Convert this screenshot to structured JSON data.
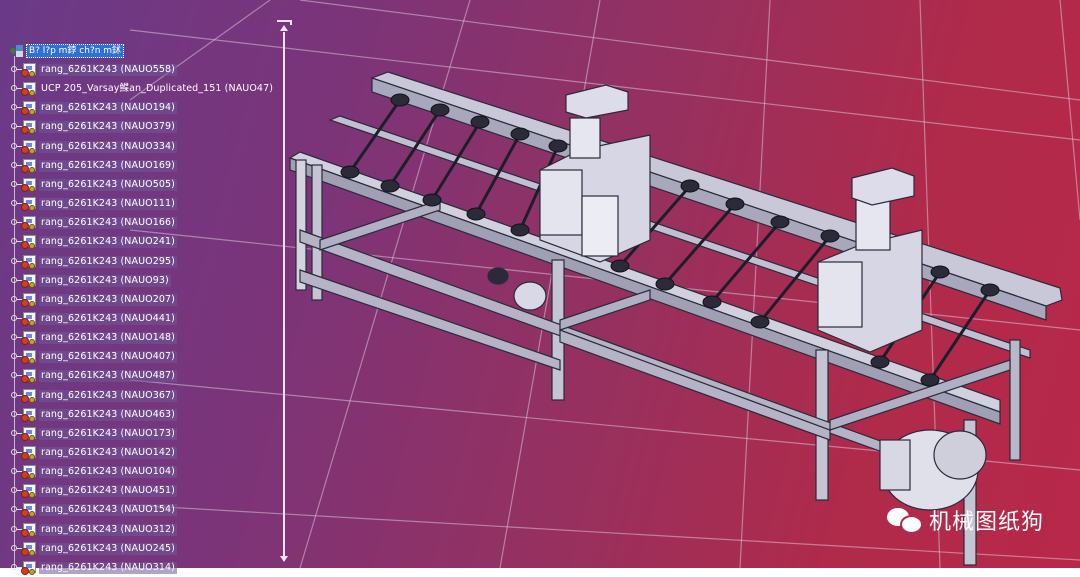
{
  "viewport": {
    "background_left": "#6a3a88",
    "background_right": "#b8284a"
  },
  "tree": {
    "root_label": "B? l?p m鋍 ch?n m鉥",
    "items": [
      {
        "label": "rang_6261K243 (NAUO558)",
        "icon": "part-icon"
      },
      {
        "label": "UCP 205_Varsay鰈an_Duplicated_151 (NAUO47)",
        "icon": "bearing-part-icon"
      },
      {
        "label": "rang_6261K243 (NAUO194)",
        "icon": "part-icon"
      },
      {
        "label": "rang_6261K243 (NAUO379)",
        "icon": "part-icon"
      },
      {
        "label": "rang_6261K243 (NAUO334)",
        "icon": "part-icon"
      },
      {
        "label": "rang_6261K243 (NAUO169)",
        "icon": "part-icon"
      },
      {
        "label": "rang_6261K243 (NAUO505)",
        "icon": "part-icon"
      },
      {
        "label": "rang_6261K243 (NAUO111)",
        "icon": "part-icon"
      },
      {
        "label": "rang_6261K243 (NAUO166)",
        "icon": "part-icon"
      },
      {
        "label": "rang_6261K243 (NAUO241)",
        "icon": "part-icon"
      },
      {
        "label": "rang_6261K243 (NAUO295)",
        "icon": "part-icon"
      },
      {
        "label": "rang_6261K243 (NAUO93)",
        "icon": "part-icon"
      },
      {
        "label": "rang_6261K243 (NAUO207)",
        "icon": "part-icon"
      },
      {
        "label": "rang_6261K243 (NAUO441)",
        "icon": "part-icon"
      },
      {
        "label": "rang_6261K243 (NAUO148)",
        "icon": "part-icon"
      },
      {
        "label": "rang_6261K243 (NAUO407)",
        "icon": "part-icon"
      },
      {
        "label": "rang_6261K243 (NAUO487)",
        "icon": "part-icon"
      },
      {
        "label": "rang_6261K243 (NAUO367)",
        "icon": "part-icon"
      },
      {
        "label": "rang_6261K243 (NAUO463)",
        "icon": "part-icon"
      },
      {
        "label": "rang_6261K243 (NAUO173)",
        "icon": "part-icon"
      },
      {
        "label": "rang_6261K243 (NAUO142)",
        "icon": "part-icon"
      },
      {
        "label": "rang_6261K243 (NAUO104)",
        "icon": "part-icon"
      },
      {
        "label": "rang_6261K243 (NAUO451)",
        "icon": "part-icon"
      },
      {
        "label": "rang_6261K243 (NAUO154)",
        "icon": "part-icon"
      },
      {
        "label": "rang_6261K243 (NAUO312)",
        "icon": "part-icon"
      },
      {
        "label": "rang_6261K243 (NAUO245)",
        "icon": "part-icon"
      },
      {
        "label": "rang_6261K243 (NAUO314)",
        "icon": "part-icon"
      }
    ]
  },
  "watermark": {
    "text": "机械图纸狗",
    "icon": "wechat-icon"
  }
}
